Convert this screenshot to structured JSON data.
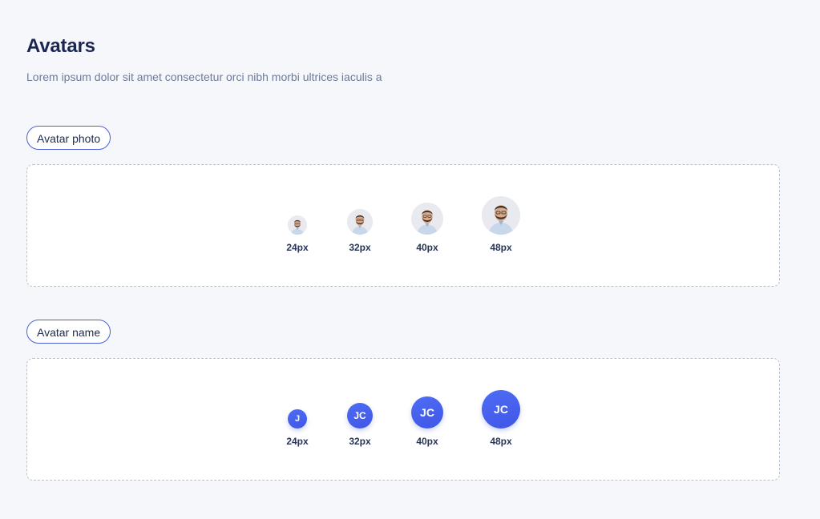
{
  "page": {
    "title": "Avatars",
    "subtitle": "Lorem ipsum dolor sit amet consectetur orci nibh morbi ultrices iaculis a"
  },
  "sections": {
    "photo": {
      "tag": "Avatar photo",
      "sizes": [
        "24px",
        "32px",
        "40px",
        "48px"
      ]
    },
    "name": {
      "tag": "Avatar name",
      "sizes": [
        "24px",
        "32px",
        "40px",
        "48px"
      ],
      "initials": [
        "J",
        "JC",
        "JC",
        "JC"
      ]
    }
  },
  "colors": {
    "accent": "#4a5fd8",
    "avatar_fill": "#4f6df5",
    "title": "#1a2650",
    "subtitle": "#6e7b9a"
  }
}
